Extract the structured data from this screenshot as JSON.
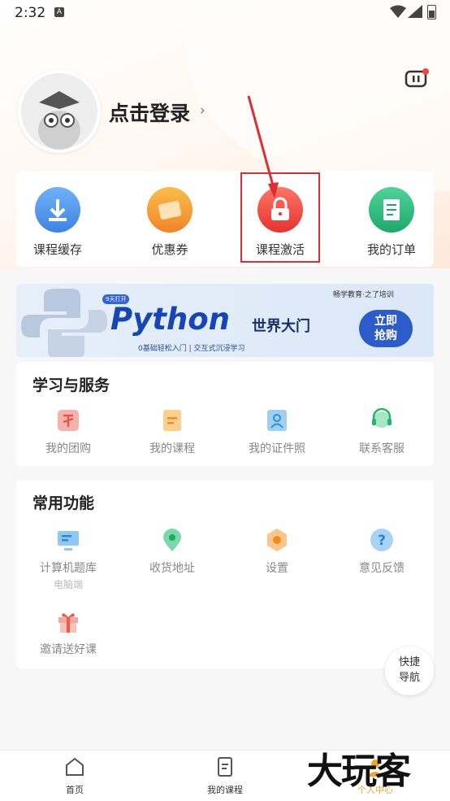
{
  "status_bar": {
    "time": "2:32",
    "badge": "A"
  },
  "profile": {
    "login_text": "点击登录",
    "arrow": "›"
  },
  "quick_actions": [
    {
      "label": "课程缓存",
      "icon": "download-icon",
      "color": "#4a8ee8"
    },
    {
      "label": "优惠券",
      "icon": "coupon-icon",
      "color": "#f59a2a"
    },
    {
      "label": "课程激活",
      "icon": "lock-icon",
      "color": "#ec4a45"
    },
    {
      "label": "我的订单",
      "icon": "order-icon",
      "color": "#29b879"
    }
  ],
  "banner": {
    "tag": "9天打开",
    "brand": "畅学教育·之了培训",
    "title": "Python",
    "title2": "世界大门",
    "subtitle": "0基础轻松入门  |  交互式沉浸学习",
    "button": "立即\n抢购"
  },
  "study_services": {
    "title": "学习与服务",
    "items": [
      {
        "label": "我的团购",
        "icon": "group-buy-icon"
      },
      {
        "label": "我的课程",
        "icon": "course-icon"
      },
      {
        "label": "我的证件照",
        "icon": "id-photo-icon"
      },
      {
        "label": "联系客服",
        "icon": "customer-service-icon"
      }
    ]
  },
  "common_functions": {
    "title": "常用功能",
    "items": [
      {
        "label": "计算机题库",
        "sublabel": "电脑端",
        "icon": "computer-icon"
      },
      {
        "label": "收货地址",
        "icon": "location-icon"
      },
      {
        "label": "设置",
        "icon": "settings-icon"
      },
      {
        "label": "意见反馈",
        "icon": "feedback-icon"
      },
      {
        "label": "邀请送好课",
        "icon": "gift-icon"
      }
    ]
  },
  "floating": {
    "line1": "快捷",
    "line2": "导航"
  },
  "tabbar": [
    {
      "label": "首页",
      "icon": "home-icon"
    },
    {
      "label": "我的课程",
      "icon": "my-course-icon"
    },
    {
      "label": "个人中心",
      "icon": "profile-icon"
    }
  ],
  "watermark": "大玩客"
}
